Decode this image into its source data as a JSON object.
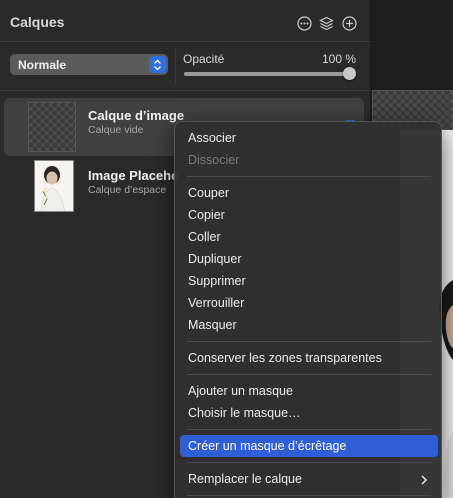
{
  "panel": {
    "title": "Calques",
    "header_icons": [
      "more-options-icon",
      "layers-stack-icon",
      "add-layer-icon"
    ],
    "blend_mode": {
      "value": "Normale"
    },
    "opacity": {
      "label": "Opacité",
      "value_text": "100 %",
      "value": 100
    },
    "layers": [
      {
        "name": "Calque d’image",
        "subtitle": "Calque vide",
        "selected": true
      },
      {
        "name": "Image Placeho",
        "subtitle": "Calque d’espace",
        "selected": false
      }
    ]
  },
  "context_menu": {
    "groups": [
      [
        {
          "label": "Associer",
          "enabled": true
        },
        {
          "label": "Dissocier",
          "enabled": false
        }
      ],
      [
        {
          "label": "Couper",
          "enabled": true
        },
        {
          "label": "Copier",
          "enabled": true
        },
        {
          "label": "Coller",
          "enabled": true
        },
        {
          "label": "Dupliquer",
          "enabled": true
        },
        {
          "label": "Supprimer",
          "enabled": true
        },
        {
          "label": "Verrouiller",
          "enabled": true
        },
        {
          "label": "Masquer",
          "enabled": true
        }
      ],
      [
        {
          "label": "Conserver les zones transparentes",
          "enabled": true
        }
      ],
      [
        {
          "label": "Ajouter un masque",
          "enabled": true
        },
        {
          "label": "Choisir le masque…",
          "enabled": true
        }
      ],
      [
        {
          "label": "Créer un masque d’écrêtage",
          "enabled": true,
          "highlighted": true
        }
      ],
      [
        {
          "label": "Remplacer le calque",
          "enabled": true,
          "submenu": true
        }
      ]
    ]
  },
  "colors": {
    "accent": "#2f5fd6",
    "panel_bg": "#2a2a2a",
    "menu_bg": "#303030"
  }
}
